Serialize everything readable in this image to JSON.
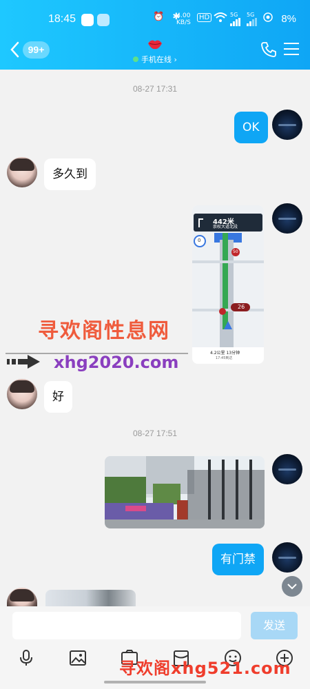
{
  "status_bar": {
    "time": "18:45",
    "speed": "4.00",
    "speed_unit": "KB/S",
    "hd": "HD",
    "signal1": "5G",
    "signal2": "5G",
    "battery": "8%"
  },
  "header": {
    "unread_count": "99+",
    "status": "手机在线 ›",
    "accent": "#0fa6f5"
  },
  "messages": [
    {
      "type": "timestamp",
      "text": "08-27 17:31"
    },
    {
      "type": "text",
      "from": "self",
      "text": "OK"
    },
    {
      "type": "text",
      "from": "peer",
      "text": "多久到"
    },
    {
      "type": "image",
      "from": "self",
      "content": "navigation-screenshot"
    },
    {
      "type": "text",
      "from": "peer",
      "text": "好"
    },
    {
      "type": "timestamp",
      "text": "08-27 17:51"
    },
    {
      "type": "image",
      "from": "self",
      "content": "gate-photo"
    },
    {
      "type": "text",
      "from": "self",
      "text": "有门禁"
    },
    {
      "type": "image",
      "from": "peer",
      "content": "building-photo"
    }
  ],
  "nav_image": {
    "distance": "442米",
    "road": "崇权大道北段",
    "speed": "0",
    "speed_limit": "50",
    "eta": "4.2公里 13分钟",
    "arrive": "17:45到达",
    "turn_badge": "26"
  },
  "watermark": {
    "title": "寻欢阁性息网",
    "url": "xhg2020.com"
  },
  "input": {
    "placeholder": "",
    "send_label": "发送"
  },
  "toolbar_icons": [
    "microphone-icon",
    "gallery-icon",
    "image-icon",
    "red-packet-icon",
    "emoji-icon",
    "plus-icon"
  ],
  "ad_overlay": "寻欢阁xhg521.com"
}
